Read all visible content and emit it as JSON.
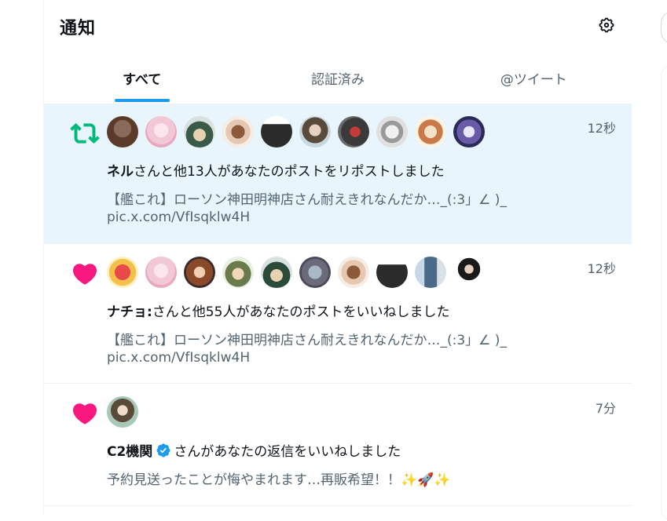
{
  "header": {
    "title": "通知"
  },
  "tabs": [
    {
      "label": "すべて",
      "active": true
    },
    {
      "label": "認証済み",
      "active": false
    },
    {
      "label": "@ツイート",
      "active": false
    }
  ],
  "colors": {
    "accent": "#1d9bf0",
    "retweet": "#00ba7c",
    "like": "#f91880",
    "highlight_bg": "#e8f5fd"
  },
  "notifications": [
    {
      "type": "retweet",
      "icon": "retweet-icon",
      "time": "12秒",
      "actor": "ネル",
      "action": "さんと他13人があなたのポストをリポストしました",
      "body_line1": "【艦これ】ローソン神田明神店さん耐えきれなんだか…_(:3」∠ )_",
      "body_line2": "pic.x.com/VfIsqklw4H",
      "avatars": [
        "#5a3b2a",
        "#f2c8d6",
        "#3a5a4a",
        "#b98a6a",
        "#2b2b2b",
        "#7a6a5a",
        "#8a4a3a",
        "#d8d8d8",
        "#e8b88a",
        "#4a4a8a"
      ]
    },
    {
      "type": "like",
      "icon": "heart-icon",
      "time": "12秒",
      "actor": "ナチョ:",
      "action": "さんと他55人があなたのポストをいいねしました",
      "body_line1": "【艦これ】ローソン神田明神店さん耐えきれなんだか…_(:3」∠ )_",
      "body_line2": "pic.x.com/VfIsqklw4H",
      "avatars": [
        "#f5c04a",
        "#f2c8d6",
        "#8a4a2a",
        "#6a7a4a",
        "#2a4a3a",
        "#6a6a7a",
        "#b98a6a",
        "#2b2b2b",
        "#4a6a8a",
        "#1a1a1a"
      ]
    },
    {
      "type": "like",
      "icon": "heart-icon",
      "time": "7分",
      "actor": "C2機関",
      "action": "さんがあなたの返信をいいねしました",
      "body_line1": "予約見送ったことが悔やまれます…再販希望！！✨🚀✨",
      "avatars": [
        "#5a7a6a"
      ]
    }
  ]
}
